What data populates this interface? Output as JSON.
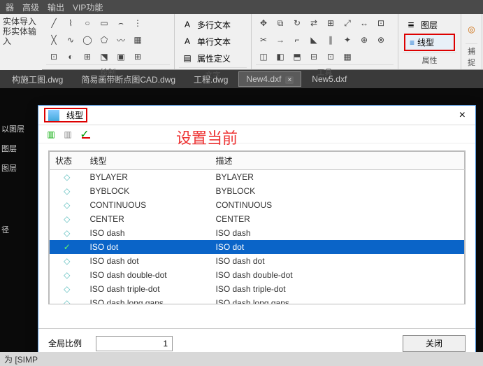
{
  "menubar": {
    "items": [
      "器",
      "高级",
      "输出",
      "VIP功能"
    ]
  },
  "side_labels": {
    "a": "实体导入",
    "b": "形实体输入"
  },
  "ribbon": {
    "group_draw": "绘制",
    "group_text": "文字",
    "group_tools": "工具",
    "group_props": "属性",
    "text_rows": {
      "a": "多行文本",
      "b": "单行文本",
      "c": "属性定义"
    },
    "layer_btn": "图层",
    "linetype_btn": "线型",
    "snap": "捕捉"
  },
  "tabs": [
    {
      "label": "构施工图.dwg"
    },
    {
      "label": "简易画带断点图CAD.dwg"
    },
    {
      "label": "工程.dwg"
    },
    {
      "label": "New4.dxf",
      "active": true,
      "closable": true
    },
    {
      "label": "New5.dxf"
    }
  ],
  "leftpanel": {
    "a": "以图层",
    "b": "图层",
    "c": "图层",
    "d": "径"
  },
  "dialog": {
    "title": "线型",
    "annotation": "设置当前",
    "cols": {
      "state": "状态",
      "linetype": "线型",
      "desc": "描述"
    },
    "rows": [
      {
        "lt": "BYLAYER",
        "desc": "BYLAYER"
      },
      {
        "lt": "BYBLOCK",
        "desc": "BYBLOCK"
      },
      {
        "lt": "CONTINUOUS",
        "desc": "CONTINUOUS"
      },
      {
        "lt": "CENTER",
        "desc": "CENTER"
      },
      {
        "lt": "ISO dash",
        "desc": "ISO dash"
      },
      {
        "lt": "ISO dot",
        "desc": "ISO dot",
        "sel": true,
        "check": true
      },
      {
        "lt": "ISO dash dot",
        "desc": "ISO dash dot"
      },
      {
        "lt": "ISO dash double-dot",
        "desc": "ISO dash double-dot"
      },
      {
        "lt": "ISO dash triple-dot",
        "desc": "ISO dash triple-dot"
      },
      {
        "lt": "ISO dash long gaps",
        "desc": "ISO dash long gaps"
      }
    ],
    "scale_label": "全局比例",
    "scale_value": "1",
    "close": "关闭"
  },
  "status": {
    "text": "为 [SIMP"
  }
}
